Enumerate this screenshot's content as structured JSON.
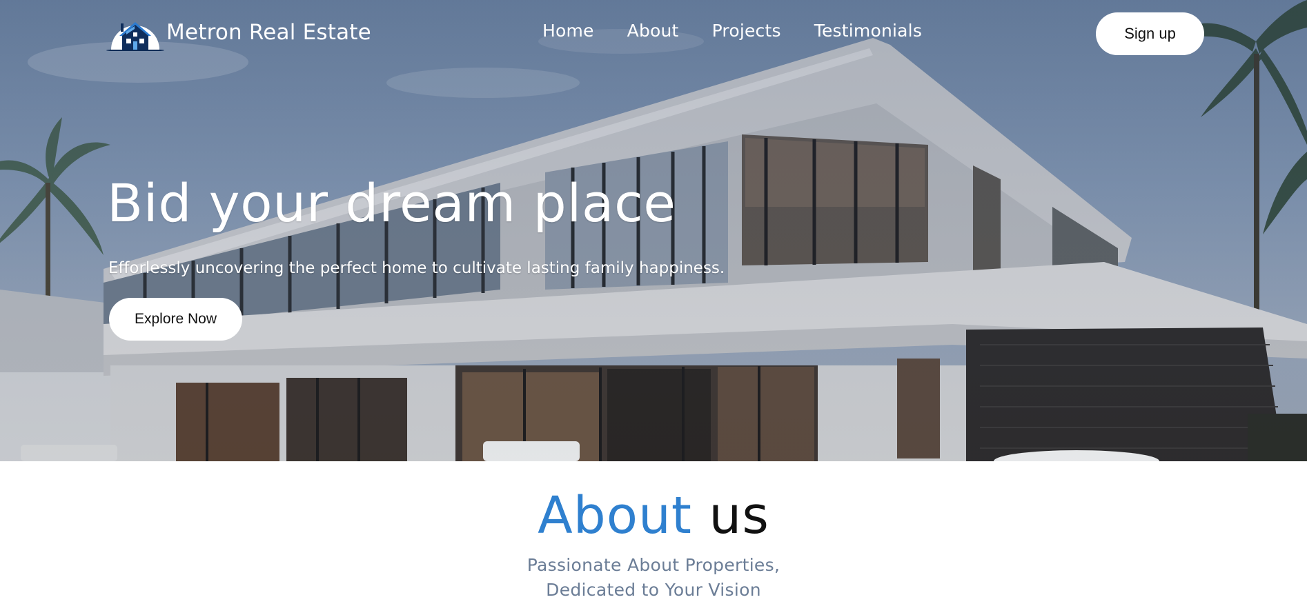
{
  "brand": {
    "name": "Metron Real Estate",
    "logo_icon": "house-logo-icon"
  },
  "nav": {
    "items": [
      {
        "label": "Home"
      },
      {
        "label": "About"
      },
      {
        "label": "Projects"
      },
      {
        "label": "Testimonials"
      }
    ],
    "signup_label": "Sign up"
  },
  "hero": {
    "title": "Bid your dream place",
    "subtitle": "Efforlessly uncovering the perfect home to cultivate lasting family happiness.",
    "cta_label": "Explore Now"
  },
  "about": {
    "title_accent": "About",
    "title_rest": "us",
    "subtitle_line1": "Passionate About Properties,",
    "subtitle_line2": "Dedicated to Your Vision"
  },
  "colors": {
    "accent": "#2f80cf",
    "subtitle_gray": "#6b7d96",
    "button_bg": "#ffffff"
  }
}
